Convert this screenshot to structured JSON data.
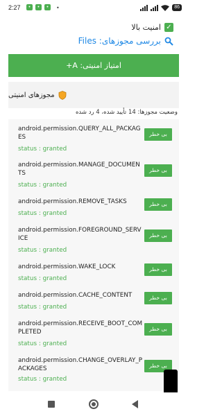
{
  "status_bar": {
    "time": "2:27",
    "notifications": [
      "chat-notification-icon",
      "message-notification-icon",
      "media-notification-icon"
    ],
    "dots": "•",
    "battery": "86"
  },
  "header": {
    "security_level": "امنیت بالا",
    "check_permissions": "بررسی مجوزهای: Files"
  },
  "score_banner": "امتیاز امنیتی: A+",
  "permissions_section": {
    "title": "مجوزهای امنیتی"
  },
  "summary": "وضعیت مجوزها: 14 تأیید شده، 4 رد شده",
  "permissions": [
    {
      "name": "android.permission.QUERY_ALL_PACKAGES",
      "status": "status : granted",
      "badge": "بی خطر"
    },
    {
      "name": "android.permission.MANAGE_DOCUMENTS",
      "status": "status : granted",
      "badge": "بی خطر"
    },
    {
      "name": "android.permission.REMOVE_TASKS",
      "status": "status : granted",
      "badge": "بی خطر"
    },
    {
      "name": "android.permission.FOREGROUND_SERVICE",
      "status": "status : granted",
      "badge": "بی خطر"
    },
    {
      "name": "android.permission.WAKE_LOCK",
      "status": "status : granted",
      "badge": "بی خطر"
    },
    {
      "name": "android.permission.CACHE_CONTENT",
      "status": "status : granted",
      "badge": "بی خطر"
    },
    {
      "name": "android.permission.RECEIVE_BOOT_COMPLETED",
      "status": "status : granted",
      "badge": "بی خطر"
    },
    {
      "name": "android.permission.CHANGE_OVERLAY_PACKAGES",
      "status": "status : granted",
      "badge": "بی خطر"
    }
  ],
  "colors": {
    "accent_green": "#4caf50",
    "link_blue": "#1e88e5",
    "section_bg": "#f3f3f3"
  }
}
